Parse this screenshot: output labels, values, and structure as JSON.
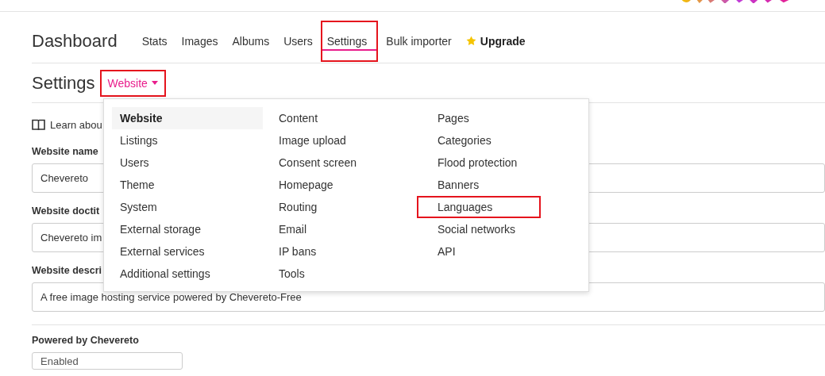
{
  "nav": {
    "title": "Dashboard",
    "tabs": [
      {
        "label": "Stats",
        "kind": "link",
        "selected": false,
        "highlighted": false
      },
      {
        "label": "Images",
        "kind": "link",
        "selected": false,
        "highlighted": false
      },
      {
        "label": "Albums",
        "kind": "link",
        "selected": false,
        "highlighted": false
      },
      {
        "label": "Users",
        "kind": "link",
        "selected": false,
        "highlighted": false
      },
      {
        "label": "Settings",
        "kind": "link",
        "selected": true,
        "highlighted": true
      },
      {
        "label": "Bulk importer",
        "kind": "link",
        "selected": false,
        "highlighted": false
      },
      {
        "label": "Upgrade",
        "kind": "upgrade",
        "selected": false,
        "highlighted": false
      }
    ]
  },
  "header": {
    "title": "Settings",
    "dropdown": {
      "label": "Website",
      "highlighted": true
    }
  },
  "menu": {
    "columns": [
      [
        {
          "label": "Website",
          "selected": true,
          "highlighted": false
        },
        {
          "label": "Listings",
          "selected": false,
          "highlighted": false
        },
        {
          "label": "Users",
          "selected": false,
          "highlighted": false
        },
        {
          "label": "Theme",
          "selected": false,
          "highlighted": false
        },
        {
          "label": "System",
          "selected": false,
          "highlighted": false
        },
        {
          "label": "External storage",
          "selected": false,
          "highlighted": false
        },
        {
          "label": "External services",
          "selected": false,
          "highlighted": false
        },
        {
          "label": "Additional settings",
          "selected": false,
          "highlighted": false
        }
      ],
      [
        {
          "label": "Content",
          "selected": false,
          "highlighted": false
        },
        {
          "label": "Image upload",
          "selected": false,
          "highlighted": false
        },
        {
          "label": "Consent screen",
          "selected": false,
          "highlighted": false
        },
        {
          "label": "Homepage",
          "selected": false,
          "highlighted": false
        },
        {
          "label": "Routing",
          "selected": false,
          "highlighted": false
        },
        {
          "label": "Email",
          "selected": false,
          "highlighted": false
        },
        {
          "label": "IP bans",
          "selected": false,
          "highlighted": false
        },
        {
          "label": "Tools",
          "selected": false,
          "highlighted": false
        }
      ],
      [
        {
          "label": "Pages",
          "selected": false,
          "highlighted": false
        },
        {
          "label": "Categories",
          "selected": false,
          "highlighted": false
        },
        {
          "label": "Flood protection",
          "selected": false,
          "highlighted": false
        },
        {
          "label": "Banners",
          "selected": false,
          "highlighted": false
        },
        {
          "label": "Languages",
          "selected": false,
          "highlighted": true
        },
        {
          "label": "Social networks",
          "selected": false,
          "highlighted": false
        },
        {
          "label": "API",
          "selected": false,
          "highlighted": false
        }
      ]
    ]
  },
  "form": {
    "learn_link": "Learn abou",
    "fields": [
      {
        "kind": "text",
        "label": "Website name",
        "value": "Chevereto"
      },
      {
        "kind": "text",
        "label": "Website doctit",
        "value": "Chevereto im"
      },
      {
        "kind": "text",
        "label": "Website descri",
        "value": "A free image hosting service powered by Chevereto-Free"
      },
      {
        "kind": "select",
        "label": "Powered by Chevereto",
        "value": "Enabled"
      }
    ]
  }
}
